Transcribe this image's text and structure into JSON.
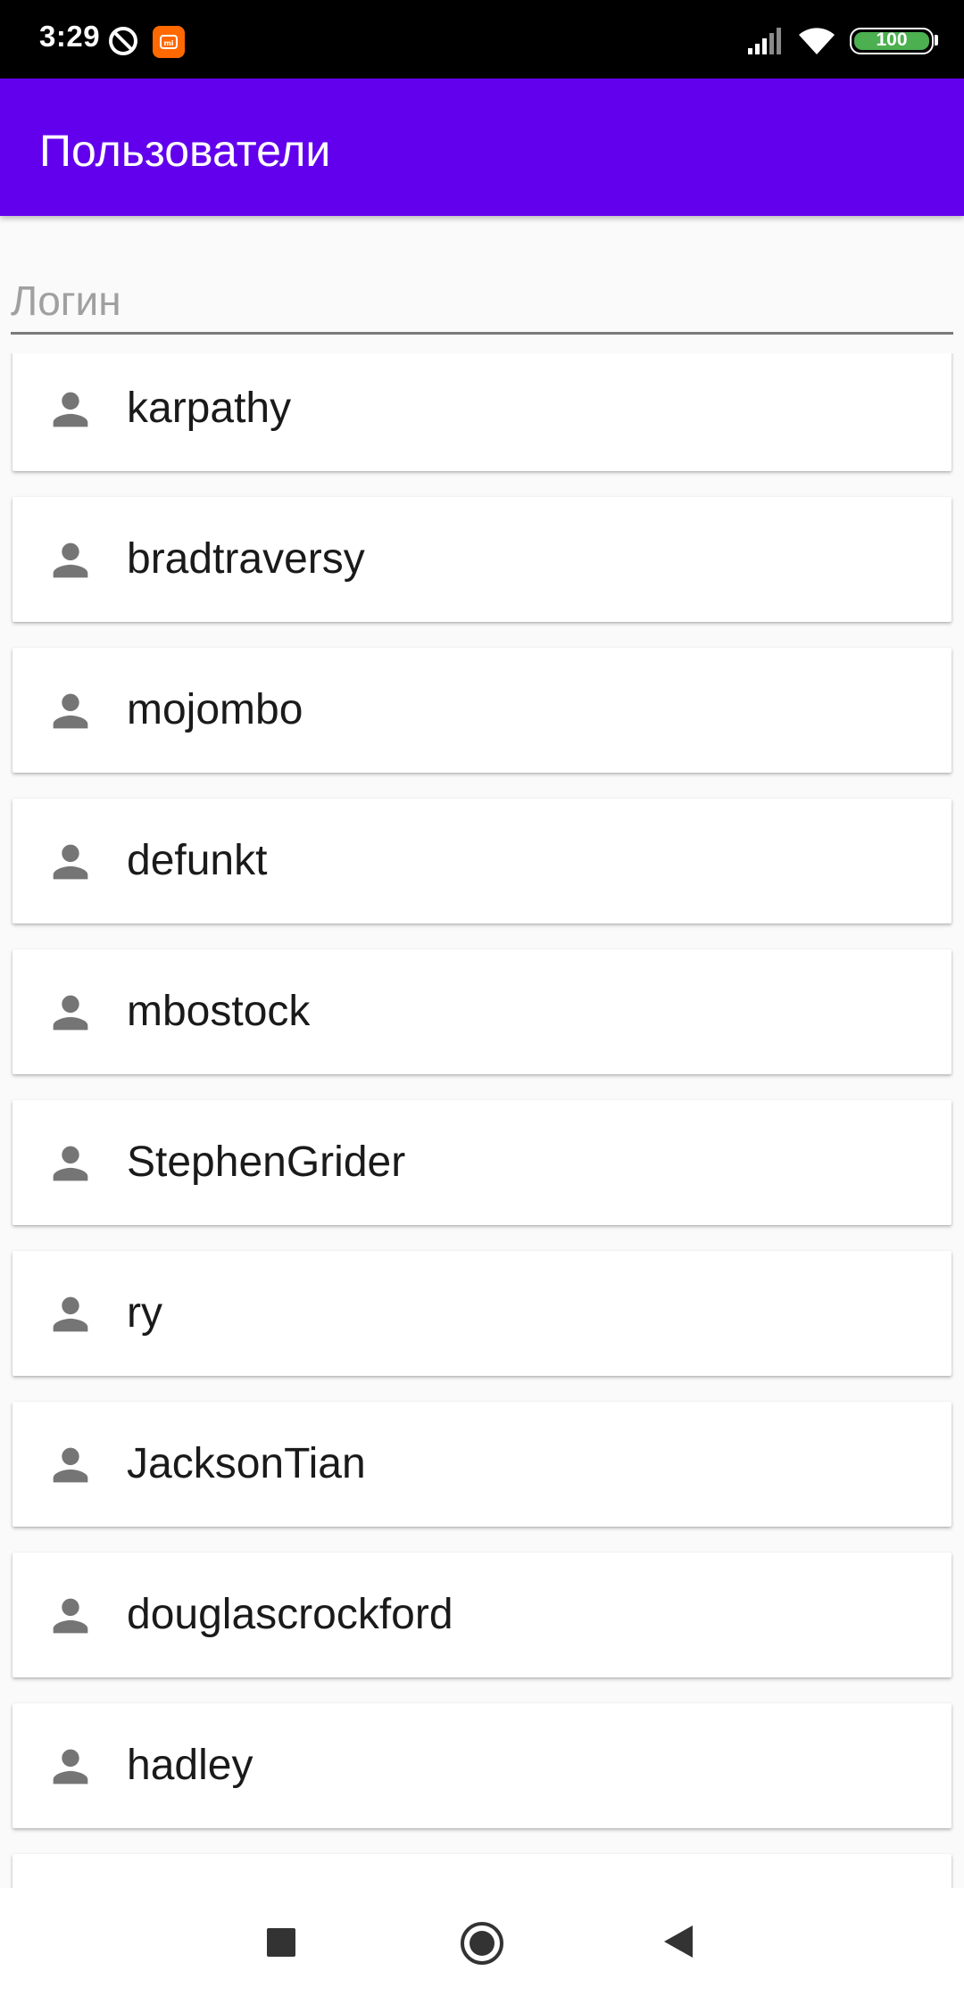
{
  "status_bar": {
    "time": "3:29",
    "battery_level": "100",
    "icons": [
      "do-not-disturb-icon",
      "mi-app-icon",
      "cellular-signal-icon",
      "wifi-icon",
      "battery-icon"
    ]
  },
  "app_bar": {
    "title": "Пользователи",
    "color": "#6200ee"
  },
  "search": {
    "placeholder": "Логин",
    "value": ""
  },
  "users": [
    {
      "login": "karpathy",
      "icon": "person-icon"
    },
    {
      "login": "bradtraversy",
      "icon": "person-icon"
    },
    {
      "login": "mojombo",
      "icon": "person-icon"
    },
    {
      "login": "defunkt",
      "icon": "person-icon"
    },
    {
      "login": "mbostock",
      "icon": "person-icon"
    },
    {
      "login": "StephenGrider",
      "icon": "person-icon"
    },
    {
      "login": "ry",
      "icon": "person-icon"
    },
    {
      "login": "JacksonTian",
      "icon": "person-icon"
    },
    {
      "login": "douglascrockford",
      "icon": "person-icon"
    },
    {
      "login": "hadley",
      "icon": "person-icon"
    }
  ],
  "nav_bar": {
    "buttons": [
      "recent-apps-icon",
      "home-icon",
      "back-icon"
    ]
  }
}
